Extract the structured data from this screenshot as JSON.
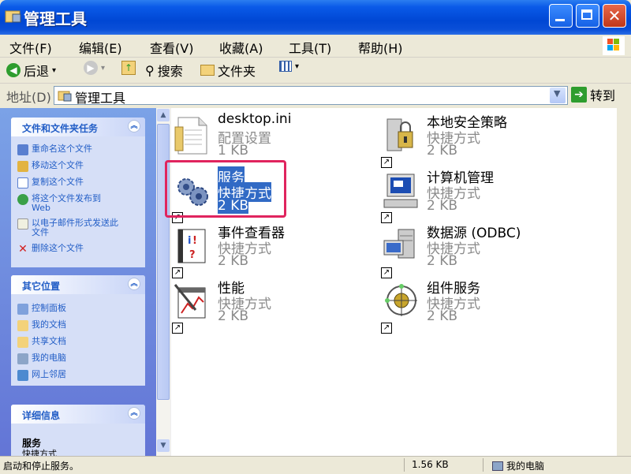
{
  "window": {
    "title": "管理工具"
  },
  "menu": [
    "文件(F)",
    "编辑(E)",
    "查看(V)",
    "收藏(A)",
    "工具(T)",
    "帮助(H)"
  ],
  "toolbar": {
    "back": "后退",
    "search": "搜索",
    "folders": "文件夹"
  },
  "address": {
    "label": "地址(D)",
    "value": "管理工具",
    "go": "转到"
  },
  "taskpane": {
    "file_tasks": {
      "title": "文件和文件夹任务",
      "items": [
        "重命名这个文件",
        "移动这个文件",
        "复制这个文件",
        "将这个文件发布到 Web",
        "以电子邮件形式发送此文件",
        "删除这个文件"
      ]
    },
    "other_places": {
      "title": "其它位置",
      "items": [
        "控制面板",
        "我的文档",
        "共享文档",
        "我的电脑",
        "网上邻居"
      ]
    },
    "details": {
      "title": "详细信息",
      "name": "服务",
      "type": "快捷方式"
    }
  },
  "files": [
    {
      "name": "desktop.ini",
      "type": "配置设置",
      "size": "1 KB",
      "icon": "ini-file-icon"
    },
    {
      "name": "本地安全策略",
      "type": "快捷方式",
      "size": "2 KB",
      "icon": "security-policy-icon"
    },
    {
      "name": "服务",
      "type": "快捷方式",
      "size": "2 KB",
      "icon": "services-gears-icon",
      "selected": true
    },
    {
      "name": "计算机管理",
      "type": "快捷方式",
      "size": "2 KB",
      "icon": "computer-management-icon"
    },
    {
      "name": "事件查看器",
      "type": "快捷方式",
      "size": "2 KB",
      "icon": "event-viewer-icon"
    },
    {
      "name": "数据源 (ODBC)",
      "type": "快捷方式",
      "size": "2 KB",
      "icon": "odbc-icon"
    },
    {
      "name": "性能",
      "type": "快捷方式",
      "size": "2 KB",
      "icon": "performance-icon"
    },
    {
      "name": "组件服务",
      "type": "快捷方式",
      "size": "2 KB",
      "icon": "component-services-icon"
    }
  ],
  "status": {
    "text": "启动和停止服务。",
    "size": "1.56 KB",
    "zone": "我的电脑"
  },
  "colors": {
    "titlebar": "#0a5ae8",
    "selection": "#316ac5",
    "highlight_box": "#e0245e",
    "taskpane": "#7ba2e7"
  }
}
